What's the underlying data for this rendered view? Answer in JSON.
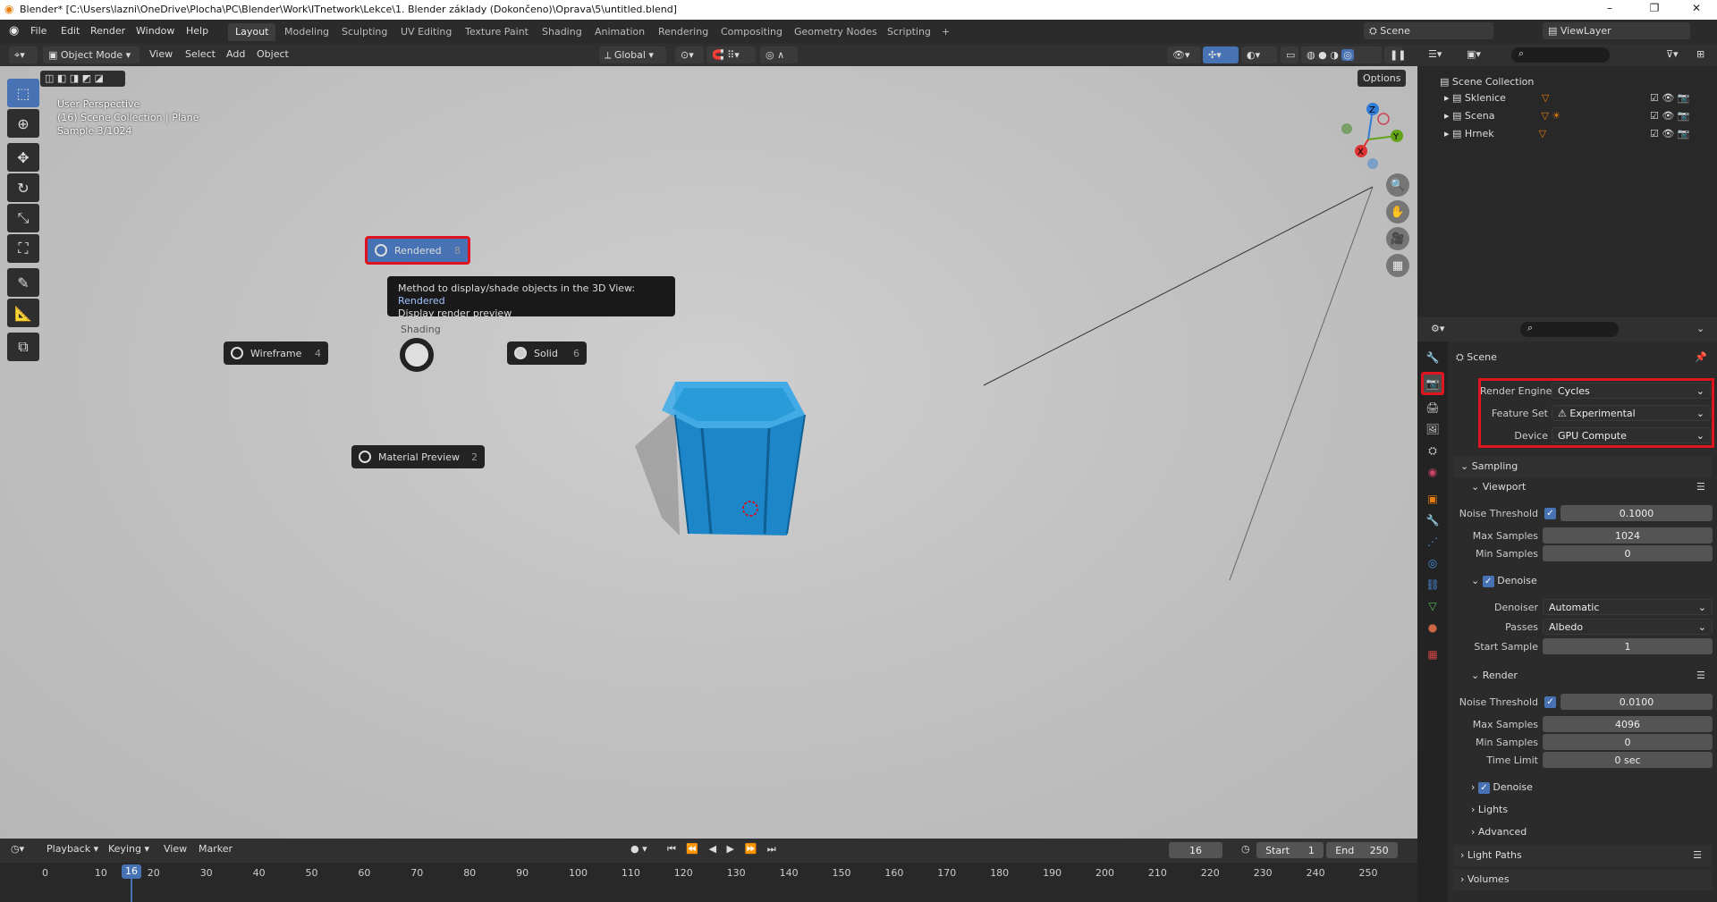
{
  "titlebar": {
    "title": "Blender* [C:\\Users\\lazni\\OneDrive\\Plocha\\PC\\Blender\\Work\\ITnetwork\\Lekce\\1. Blender základy (Dokončeno)\\Oprava\\5\\untitled.blend]",
    "min": "–",
    "max": "❐",
    "close": "✕"
  },
  "menu": {
    "items": [
      "File",
      "Edit",
      "Render",
      "Window",
      "Help"
    ]
  },
  "workspaces": [
    "Layout",
    "Modeling",
    "Sculpting",
    "UV Editing",
    "Texture Paint",
    "Shading",
    "Animation",
    "Rendering",
    "Compositing",
    "Geometry Nodes",
    "Scripting",
    "+"
  ],
  "scene_selector": "Scene",
  "viewlayer_selector": "ViewLayer",
  "header3d": {
    "mode": "Object Mode",
    "menus": [
      "View",
      "Select",
      "Add",
      "Object"
    ],
    "orientation": "Global",
    "options": "Options"
  },
  "viewport": {
    "info": [
      "User Perspective",
      "(16) Scene Collection | Plane",
      "Sample 3/1024"
    ]
  },
  "pie": {
    "rendered": {
      "label": "Rendered",
      "key": "8"
    },
    "wireframe": {
      "label": "Wireframe",
      "key": "4"
    },
    "solid": {
      "label": "Solid",
      "key": "6"
    },
    "material": {
      "label": "Material Preview",
      "key": "2"
    },
    "center_label": "Shading",
    "tooltip_line1": "Method to display/shade objects in the 3D View:",
    "tooltip_value": "Rendered",
    "tooltip_line2": "Display render preview"
  },
  "gizmo": {
    "x": "X",
    "y": "Y",
    "z": "Z"
  },
  "outliner": {
    "root": "Scene Collection",
    "items": [
      "Sklenice",
      "Scena",
      "Hrnek"
    ]
  },
  "properties": {
    "title": "Scene",
    "render_engine": {
      "label": "Render Engine",
      "value": "Cycles"
    },
    "feature_set": {
      "label": "Feature Set",
      "value": "Experimental"
    },
    "device": {
      "label": "Device",
      "value": "GPU Compute"
    },
    "sampling": "Sampling",
    "viewport": {
      "title": "Viewport",
      "noise_threshold": {
        "label": "Noise Threshold",
        "value": "0.1000"
      },
      "max_samples": {
        "label": "Max Samples",
        "value": "1024"
      },
      "min_samples": {
        "label": "Min Samples",
        "value": "0"
      }
    },
    "denoise": {
      "title": "Denoise",
      "denoiser": {
        "label": "Denoiser",
        "value": "Automatic"
      },
      "passes": {
        "label": "Passes",
        "value": "Albedo"
      },
      "start_sample": {
        "label": "Start Sample",
        "value": "1"
      }
    },
    "render": {
      "title": "Render",
      "noise_threshold": {
        "label": "Noise Threshold",
        "value": "0.0100"
      },
      "max_samples": {
        "label": "Max Samples",
        "value": "4096"
      },
      "min_samples": {
        "label": "Min Samples",
        "value": "0"
      },
      "time_limit": {
        "label": "Time Limit",
        "value": "0 sec"
      }
    },
    "sub_sections": [
      "Denoise",
      "Lights",
      "Advanced"
    ],
    "light_paths": "Light Paths",
    "volumes": "Volumes"
  },
  "timeline": {
    "menus": [
      "Playback",
      "Keying",
      "View",
      "Marker"
    ],
    "current_frame": "16",
    "start_label": "Start",
    "start": "1",
    "end_label": "End",
    "end": "250",
    "ticks": [
      "0",
      "10",
      "20",
      "30",
      "40",
      "50",
      "60",
      "70",
      "80",
      "90",
      "100",
      "110",
      "120",
      "130",
      "140",
      "150",
      "160",
      "170",
      "180",
      "190",
      "200",
      "210",
      "220",
      "230",
      "240",
      "250"
    ],
    "playhead": "16"
  }
}
